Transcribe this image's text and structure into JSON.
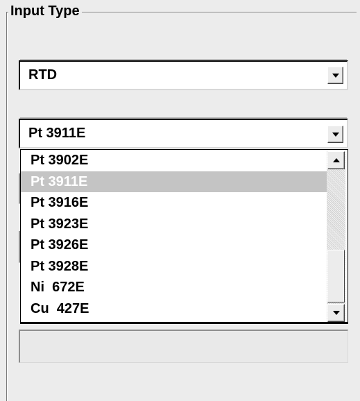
{
  "group": {
    "title": "Input Type"
  },
  "input_type_combo": {
    "value": "RTD"
  },
  "sensor_combo": {
    "value": "Pt 3911E",
    "options": [
      "Pt 3902E",
      "Pt 3911E",
      "Pt 3916E",
      "Pt 3923E",
      "Pt 3926E",
      "Pt 3928E",
      "Ni  672E",
      "Cu  427E"
    ],
    "selected_option": "Pt 3911E",
    "highlight_color": "#c4c4c4"
  }
}
